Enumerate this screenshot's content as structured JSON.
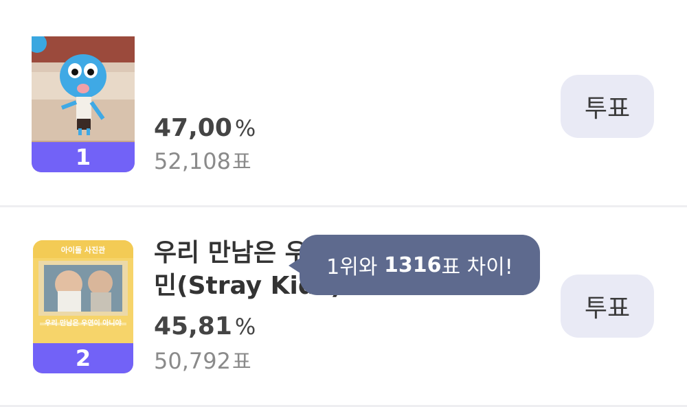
{
  "entries": [
    {
      "rank": "1",
      "name": "",
      "percent": "47,00",
      "percent_unit": "%",
      "votes": "52,108",
      "votes_unit": "표",
      "vote_button": "투표"
    },
    {
      "rank": "2",
      "name_line1": "우리 만남은 우",
      "name_line2": "민(Stray Kids)",
      "thumb_text_top": "아이돌 사진관",
      "thumb_text_bottom": "우리 만남은 우연이 아니야",
      "percent": "45,81",
      "percent_unit": "%",
      "votes": "50,792",
      "votes_unit": "표",
      "vote_button": "투표"
    }
  ],
  "tooltip": {
    "prefix": "1위와 ",
    "number": "1316",
    "suffix": "표 차이!"
  },
  "colors": {
    "rank_badge": "#7262f7",
    "vote_button_bg": "#e9eaf5",
    "tooltip_bg": "#5e6a8e",
    "divider": "#eeeef1"
  }
}
